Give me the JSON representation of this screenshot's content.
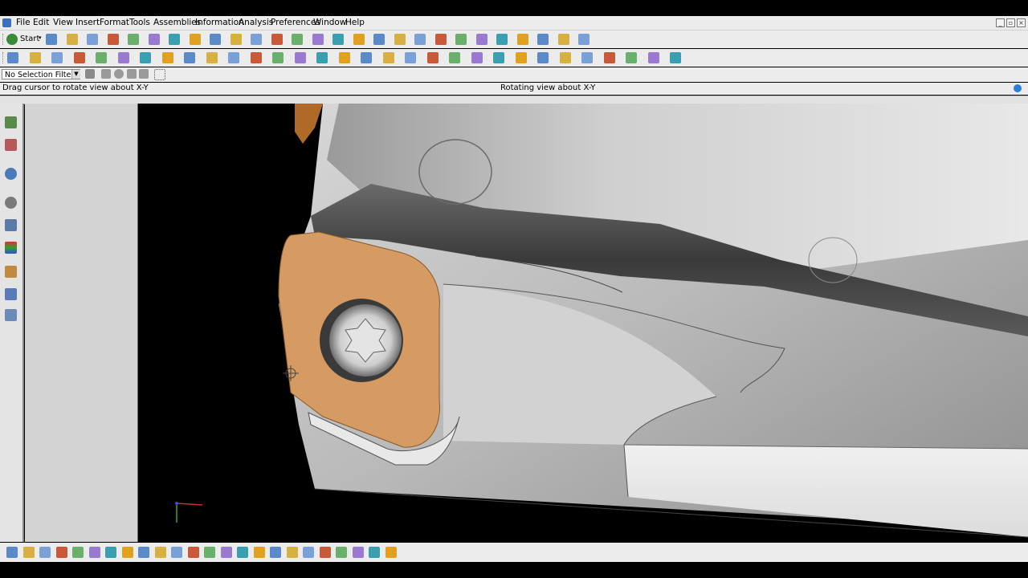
{
  "menu": {
    "items": [
      "File",
      "Edit",
      "View",
      "Insert",
      "Format",
      "Tools",
      "Assemblies",
      "Information",
      "Analysis",
      "Preferences",
      "Window",
      "Help"
    ]
  },
  "toolbar": {
    "start_label": "Start"
  },
  "selection_filter": {
    "value": "No Selection Filter"
  },
  "status": {
    "left": "Drag cursor to rotate view about X-Y",
    "center": "Rotating view about X-Y"
  },
  "icons": {
    "toolbar1": [
      "new-file-icon",
      "open-folder-icon",
      "save-icon",
      "cut-icon",
      "copy-icon",
      "paste-icon",
      "undo-icon",
      "redo-icon",
      "select-icon",
      "refresh-icon",
      "fit-icon",
      "zoom-box-icon",
      "zoom-icon",
      "rotate-icon",
      "pan-icon",
      "snap-view-icon",
      "render-style-icon",
      "orient-icon",
      "cube-view-icon",
      "camera-icon",
      "selection-icon",
      "point-icon",
      "snap-icon",
      "snap2-icon",
      "snap3-icon",
      "measure-icon",
      "ruler-icon"
    ],
    "toolbar2": [
      "sketch-icon",
      "datum-icon",
      "extrude-icon",
      "revolve-icon",
      "hole-icon",
      "feature-icon",
      "block-icon",
      "cylinder-icon",
      "cone-icon",
      "sphere-icon",
      "boss-icon",
      "pad-icon",
      "pocket-icon",
      "slot-icon",
      "groove-icon",
      "line-icon",
      "arc-icon",
      "curve-icon",
      "spline-icon",
      "trim-icon",
      "surface-icon",
      "sew-icon",
      "offset-icon",
      "trim-body-icon",
      "blend-icon",
      "chamfer-icon",
      "shell-icon",
      "draft-icon",
      "pattern-icon",
      "mirror-icon",
      "color-icon"
    ]
  },
  "colors": {
    "insert": "#d59b62",
    "viewport_bg": "#000000",
    "chrome_bg": "#ececec"
  }
}
